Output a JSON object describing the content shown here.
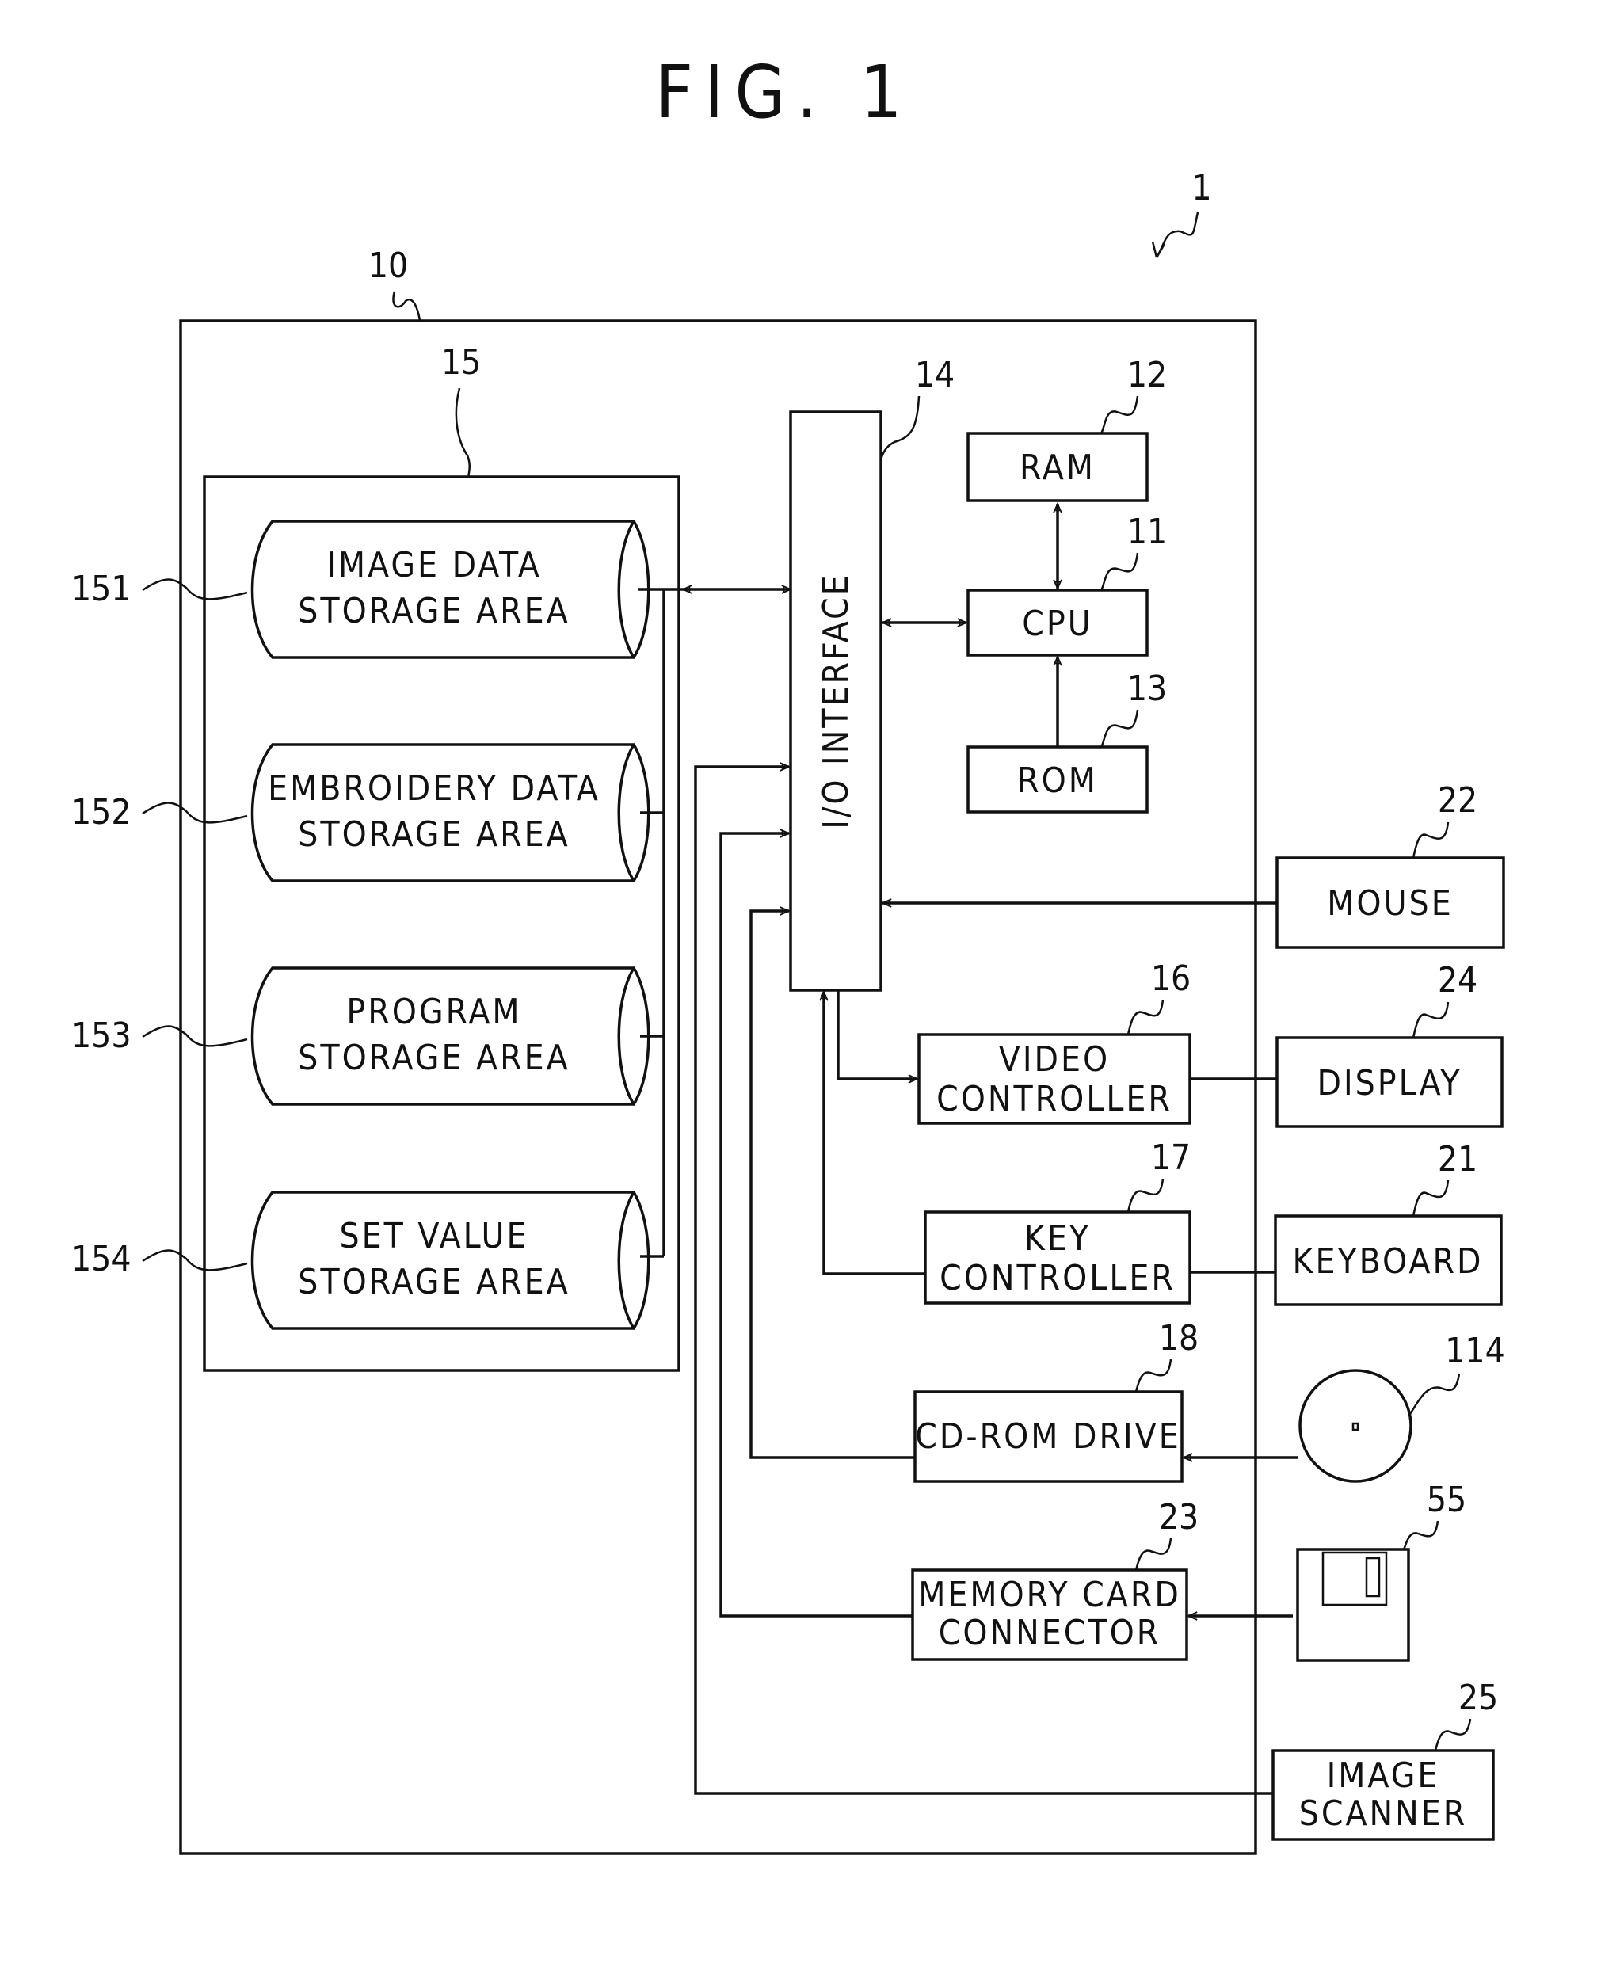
{
  "figure": {
    "title": "FIG. 1",
    "system_ref": "1"
  },
  "main_unit": {
    "ref": "10"
  },
  "storage": {
    "ref": "15",
    "areas": [
      {
        "ref": "151",
        "line1": "IMAGE DATA",
        "line2": "STORAGE AREA"
      },
      {
        "ref": "152",
        "line1": "EMBROIDERY DATA",
        "line2": "STORAGE AREA"
      },
      {
        "ref": "153",
        "line1": "PROGRAM",
        "line2": "STORAGE AREA"
      },
      {
        "ref": "154",
        "line1": "SET VALUE",
        "line2": "STORAGE AREA"
      }
    ]
  },
  "io_interface": {
    "ref": "14",
    "label": "I/O INTERFACE"
  },
  "cpu": {
    "ref": "11",
    "label": "CPU"
  },
  "ram": {
    "ref": "12",
    "label": "RAM"
  },
  "rom": {
    "ref": "13",
    "label": "ROM"
  },
  "video_controller": {
    "ref": "16",
    "line1": "VIDEO",
    "line2": "CONTROLLER"
  },
  "key_controller": {
    "ref": "17",
    "line1": "KEY",
    "line2": "CONTROLLER"
  },
  "cdrom_drive": {
    "ref": "18",
    "label": "CD-ROM DRIVE"
  },
  "memory_card_connector": {
    "ref": "23",
    "line1": "MEMORY CARD",
    "line2": "CONNECTOR"
  },
  "mouse": {
    "ref": "22",
    "label": "MOUSE"
  },
  "display": {
    "ref": "24",
    "label": "DISPLAY"
  },
  "keyboard": {
    "ref": "21",
    "label": "KEYBOARD"
  },
  "cdrom_disc": {
    "ref": "114"
  },
  "memory_card": {
    "ref": "55"
  },
  "image_scanner": {
    "ref": "25",
    "line1": "IMAGE",
    "line2": "SCANNER"
  }
}
